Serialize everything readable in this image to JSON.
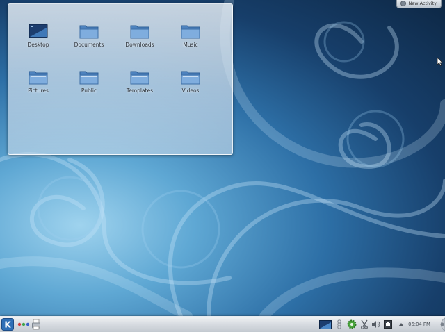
{
  "desktop": {
    "folder_view": {
      "icons": [
        {
          "label": "Desktop",
          "icon": "desktop-folder-icon"
        },
        {
          "label": "Documents",
          "icon": "folder-icon"
        },
        {
          "label": "Downloads",
          "icon": "folder-icon"
        },
        {
          "label": "Music",
          "icon": "folder-icon"
        },
        {
          "label": "Pictures",
          "icon": "folder-icon"
        },
        {
          "label": "Public",
          "icon": "folder-icon"
        },
        {
          "label": "Templates",
          "icon": "folder-icon"
        },
        {
          "label": "Videos",
          "icon": "folder-icon"
        }
      ]
    },
    "new_activity_label": "New Activity"
  },
  "panel": {
    "launcher_icon": "kde-kickoff-icon",
    "pager_icon": "activity-pager-icon",
    "task_icon": "printer-icon",
    "tray": [
      "desktop-preview-icon",
      "notifications-icon",
      "update-gear-icon",
      "clipboard-scissors-icon",
      "volume-icon",
      "network-icon",
      "expand-arrow-icon"
    ],
    "clock": "06:04 PM"
  },
  "colors": {
    "wallpaper_dark": "#0d2744",
    "wallpaper_light": "#9fd3ee",
    "folder_blue": "#5b8fc7",
    "panel": "#d9dde2"
  }
}
